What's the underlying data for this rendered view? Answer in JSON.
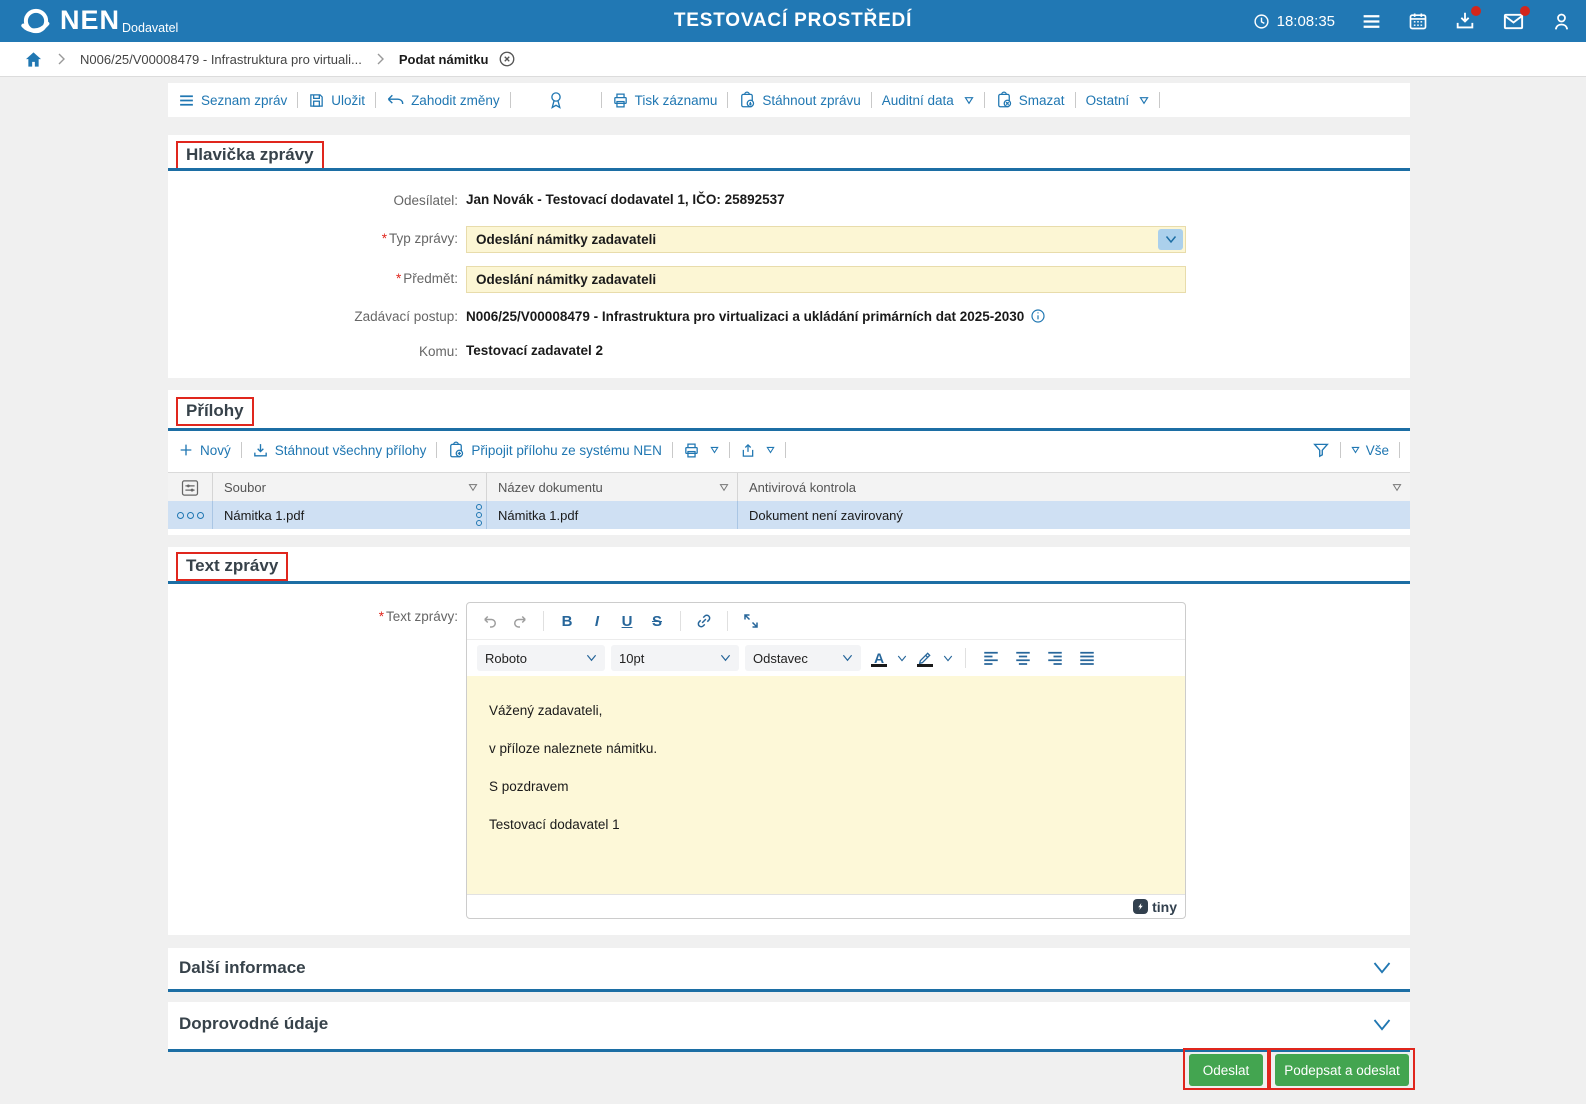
{
  "header": {
    "logo": "NEN",
    "logo_subtitle": "Dodavatel",
    "app_title": "TESTOVACÍ PROSTŘEDÍ",
    "clock": "18:08:35"
  },
  "breadcrumb": {
    "procedure": "N006/25/V00008479 - Infrastruktura pro virtuali...",
    "current": "Podat námitku"
  },
  "toolbar": {
    "items": [
      {
        "label": "Seznam zpráv"
      },
      {
        "label": "Uložit"
      },
      {
        "label": "Zahodit změny"
      },
      {
        "label": "Tisk záznamu"
      },
      {
        "label": "Stáhnout zprávu"
      },
      {
        "label": "Auditní data"
      },
      {
        "label": "Smazat"
      },
      {
        "label": "Ostatní"
      }
    ]
  },
  "hlavicka": {
    "title": "Hlavička zprávy",
    "required_marker": "*",
    "odesilatel_label": "Odesílatel:",
    "odesilatel_value": "Jan Novák - Testovací dodavatel 1, IČO: 25892537",
    "typ_zpravy_label": "Typ zprávy:",
    "typ_zpravy_value": "Odeslání námitky zadavateli",
    "predmet_label": "Předmět:",
    "predmet_value": "Odeslání námitky zadavateli",
    "zadavaci_postup_label": "Zadávací postup:",
    "zadavaci_postup_value": "N006/25/V00008479 - Infrastruktura pro virtualizaci a ukládání primárních dat 2025-2030",
    "komu_label": "Komu:",
    "komu_value": "Testovací zadavatel 2"
  },
  "prilohy": {
    "title": "Přílohy",
    "novy": "Nový",
    "stahnout_vsechny": "Stáhnout všechny přílohy",
    "pripojit": "Připojit přílohu ze systému NEN",
    "vse": "Vše",
    "columns": {
      "soubor": "Soubor",
      "nazev": "Název dokumentu",
      "antivir": "Antivirová kontrola"
    },
    "rows": [
      {
        "soubor": "Námitka 1.pdf",
        "nazev": "Námitka 1.pdf",
        "antivir": "Dokument není zavirovaný"
      }
    ]
  },
  "text_zpravy": {
    "title": "Text zprávy",
    "required_marker": "*",
    "label": "Text zprávy:",
    "editor": {
      "font_value": "Roboto",
      "size_value": "10pt",
      "block_value": "Odstavec",
      "bold": "B",
      "italic": "I",
      "underline": "U",
      "strike": "S",
      "text_color": "A",
      "paragraphs": [
        "Vážený zadavateli,",
        "v příloze naleznete námitku.",
        "S pozdravem",
        "Testovací dodavatel 1"
      ],
      "brand": "tiny"
    }
  },
  "collapsed_sections": [
    {
      "title": "Další informace"
    },
    {
      "title": "Doprovodné údaje"
    }
  ],
  "actions": {
    "odeslat": "Odeslat",
    "podepsat": "Podepsat a odeslat"
  },
  "colors": {
    "header_blue": "#2178b4",
    "accent_blue": "#1c6ea4",
    "link_blue": "#2077b2",
    "field_yellow": "#fcf6d4",
    "row_highlight": "#cfe0f3",
    "annotation_red": "#e0261d",
    "button_green": "#43a550",
    "badge_red": "#d3261c"
  }
}
